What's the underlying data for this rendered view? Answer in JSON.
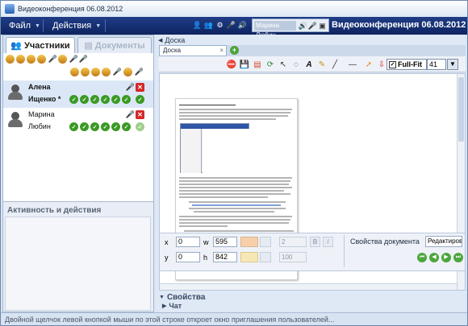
{
  "window": {
    "title": "Видеоконференция 06.08.2012"
  },
  "menu": {
    "file": "Файл",
    "actions": "Действия",
    "user_chip": "Марина Любин",
    "conference_title": "Видеоконференция 06.08.2012"
  },
  "left": {
    "tab_participants": "Участники",
    "tab_documents": "Документы",
    "participants": [
      {
        "line1": "Алена",
        "line2": "Ищенко *"
      },
      {
        "line1": "Марина",
        "line2": "Любин"
      }
    ],
    "activity_header": "Активность и действия"
  },
  "board": {
    "header": "Доска",
    "doc_tab": "Доска",
    "fullfit_label": "Full-Fit",
    "zoom_value": "41"
  },
  "props": {
    "header": "Свойства",
    "x_label": "x",
    "x_value": "0",
    "y_label": "y",
    "y_value": "0",
    "w_label": "w",
    "w_value": "595",
    "h_label": "h",
    "h_value": "842",
    "line_width": "2",
    "opacity": "100",
    "bold": "B",
    "italic": "I",
    "doc_props_label": "Свойства документа",
    "edit_select": "Редактиров"
  },
  "chat": {
    "header": "Чат"
  },
  "status": {
    "text": "Двойной щелчок левой кнопкой мыши по этой строке откроет окно приглашения пользователей..."
  }
}
